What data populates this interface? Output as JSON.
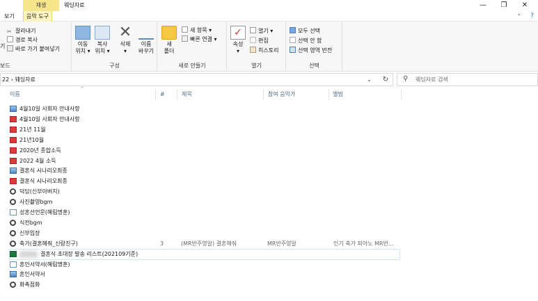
{
  "window": {
    "context_tab_label": "재생",
    "title": "웨딩자료",
    "minimize": "—",
    "maximize": "❐",
    "close": "✕"
  },
  "ribbon_tabs": [
    "보기",
    "음악 도구"
  ],
  "ribbon": {
    "clipboard": {
      "left_stub": "기",
      "cut": "잘라내기",
      "copy_path": "경로 복사",
      "paste_shortcut": "바로 가기 붙여넣기",
      "label": "보드"
    },
    "organize": {
      "move_to": [
        "이동",
        "위치 ▾"
      ],
      "copy_to": [
        "복사",
        "위치 ▾"
      ],
      "delete": [
        "삭제",
        "▾"
      ],
      "rename": [
        "이름",
        "바꾸기"
      ],
      "label": "구성"
    },
    "new": {
      "new_folder": [
        "새",
        "폴더"
      ],
      "new_item": "새 항목 ▾",
      "easy_access": "빠른 연결 ▾",
      "label": "새로 만들기"
    },
    "open": {
      "properties": [
        "속성",
        "▾"
      ],
      "open": "열기 ▾",
      "edit": "편집",
      "history": "히스토리",
      "label": "열기"
    },
    "select": {
      "select_all": "모두 선택",
      "select_none": "선택 안 함",
      "invert": "선택 영역 반전",
      "label": "선택"
    }
  },
  "address": {
    "path": "22 › 웨딩자료",
    "search_placeholder": "웨딩자료 검색"
  },
  "columns": {
    "name": "이름",
    "number": "#",
    "title": "제목",
    "artist": "참여 음악가",
    "album": "앨범"
  },
  "files": [
    {
      "type": "image",
      "name": "4월10일 사회자 안내사항",
      "number": "",
      "title": "",
      "artist": "",
      "album": ""
    },
    {
      "type": "pdf",
      "name": "4월10일 사회자 안내사항",
      "number": "",
      "title": "",
      "artist": "",
      "album": ""
    },
    {
      "type": "pdf",
      "name": "21년 11월",
      "number": "",
      "title": "",
      "artist": "",
      "album": ""
    },
    {
      "type": "pdf",
      "name": "21년10월",
      "number": "",
      "title": "",
      "artist": "",
      "album": ""
    },
    {
      "type": "pdf",
      "name": "2020년 종합소득",
      "number": "",
      "title": "",
      "artist": "",
      "album": ""
    },
    {
      "type": "pdf",
      "name": "2022 4월 소득",
      "number": "",
      "title": "",
      "artist": "",
      "album": ""
    },
    {
      "type": "image",
      "name": "결혼식 시나리오최종",
      "number": "",
      "title": "",
      "artist": "",
      "album": ""
    },
    {
      "type": "pdf",
      "name": "결혼식 시나리오최종",
      "number": "",
      "title": "",
      "artist": "",
      "album": ""
    },
    {
      "type": "audio",
      "name": "덕담(신부아버지)",
      "number": "",
      "title": "",
      "artist": "",
      "album": ""
    },
    {
      "type": "audio",
      "name": "사진촬영bgm",
      "number": "",
      "title": "",
      "artist": "",
      "album": ""
    },
    {
      "type": "doc",
      "name": "성혼선언문(혜림명훈)",
      "number": "",
      "title": "",
      "artist": "",
      "album": ""
    },
    {
      "type": "audio",
      "name": "식전bgm",
      "number": "",
      "title": "",
      "artist": "",
      "album": ""
    },
    {
      "type": "audio",
      "name": "신부입장",
      "number": "",
      "title": "",
      "artist": "",
      "album": ""
    },
    {
      "type": "audio",
      "name": "축가(결혼해줘_신랑친구)",
      "number": "3",
      "title": "(MR반주영알) 결혼해줘",
      "artist": "MR반주영알",
      "album": "인기 축가 피아노 MR반..."
    },
    {
      "type": "excel",
      "name": "결혼식 초대장 발송 리스트(202109기준)",
      "number": "",
      "title": "",
      "artist": "",
      "album": ""
    },
    {
      "type": "doc",
      "name": "혼인서약서(혜림명훈)",
      "number": "",
      "title": "",
      "artist": "",
      "album": ""
    },
    {
      "type": "image",
      "name": "혼인서약서",
      "number": "",
      "title": "",
      "artist": "",
      "album": ""
    },
    {
      "type": "audio",
      "name": "화촉점화",
      "number": "",
      "title": "",
      "artist": "",
      "album": ""
    }
  ]
}
